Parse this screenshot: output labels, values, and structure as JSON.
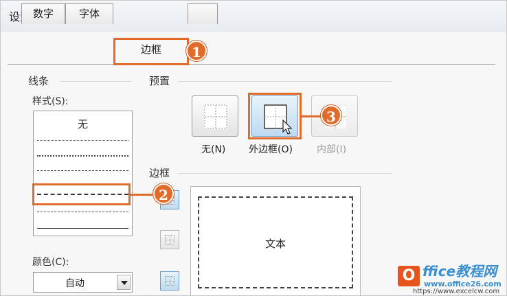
{
  "window": {
    "title": "设置单元格格式"
  },
  "tabs": [
    {
      "label": "数字"
    },
    {
      "label": "字体"
    },
    {
      "label": "边框",
      "active": true
    }
  ],
  "line_group": {
    "title": "线条",
    "style_label": "样式(S):",
    "none_label": "无",
    "styles": [
      "dotted-fine",
      "dotted",
      "dash-dot",
      "dash-dot-dot",
      "dashed",
      "thin",
      "medium"
    ],
    "selected_style": "dash-dot-dot",
    "color_label": "颜色(C):",
    "color_value": "自动"
  },
  "presets": {
    "title": "预置",
    "items": [
      {
        "label": "无(N)",
        "state": "normal"
      },
      {
        "label": "外边框(O)",
        "state": "selected"
      },
      {
        "label": "内部(I)",
        "state": "disabled"
      }
    ]
  },
  "border": {
    "title": "边框",
    "preview_text": "文本"
  },
  "callouts": [
    "1",
    "2",
    "3"
  ],
  "watermark": {
    "logo_letter": "O",
    "title": "ffice教程网",
    "url": "www.office26.com",
    "url2": "https://www.excelcw.com"
  },
  "colors": {
    "accent": "#e06b2b",
    "brand_orange": "#e8541d",
    "brand_blue": "#3b8fd1"
  }
}
